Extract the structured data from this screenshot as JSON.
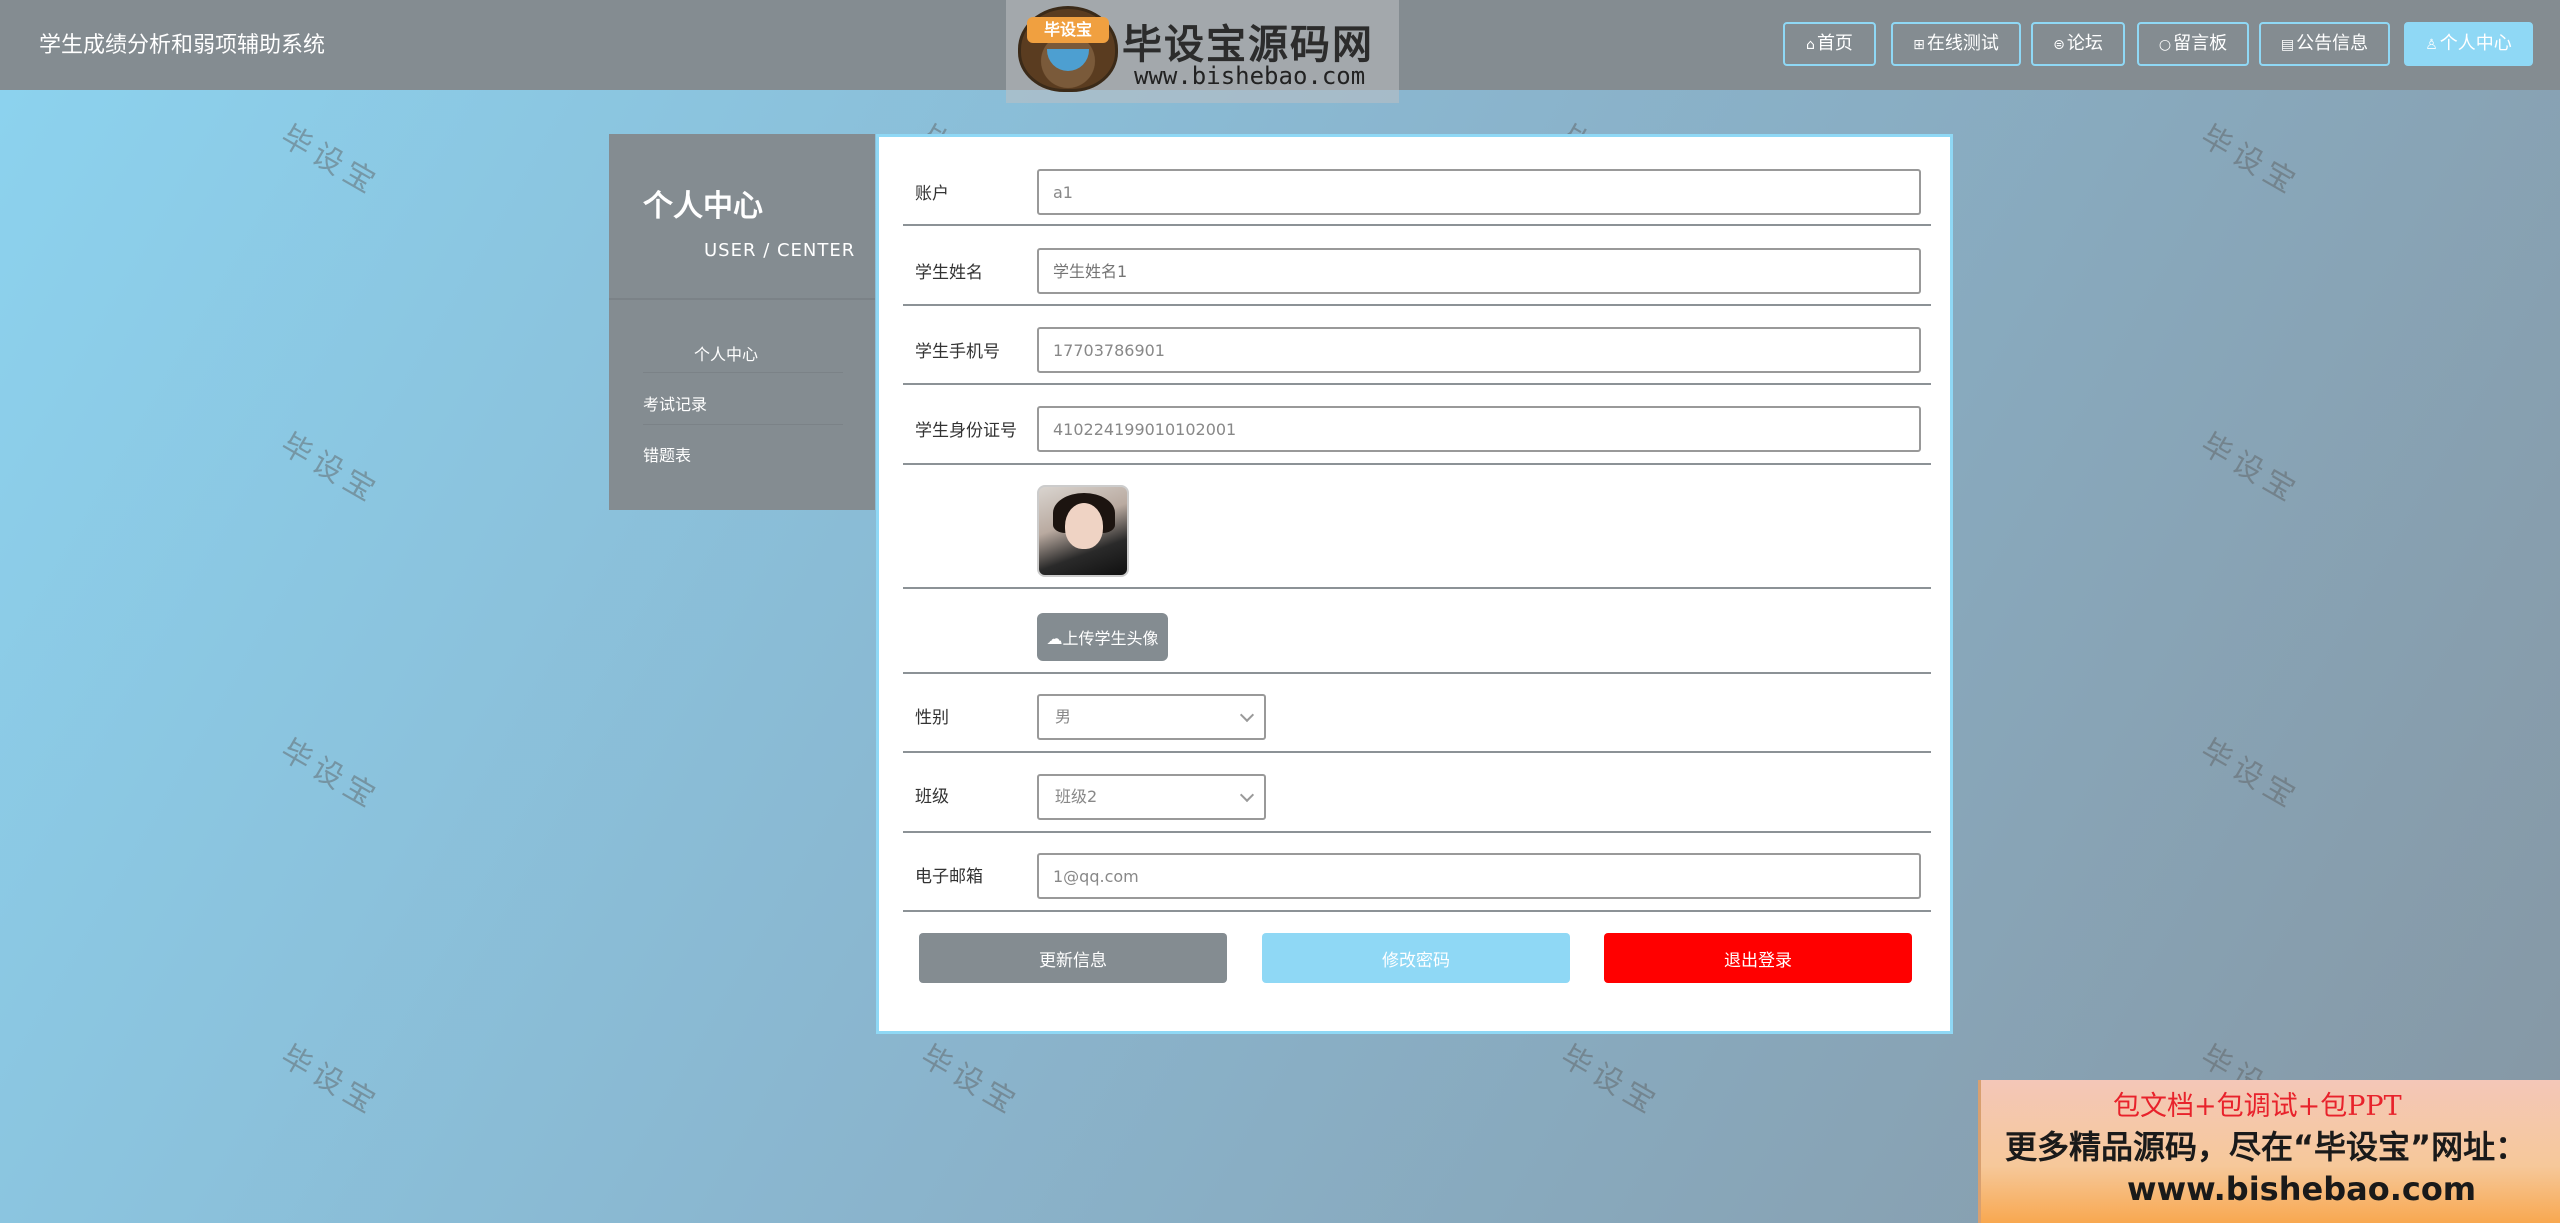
{
  "header": {
    "title": "学生成绩分析和弱项辅助系统",
    "logo": {
      "badge": "毕设宝",
      "name": "毕设宝源码网",
      "url": "www.bishebao.com"
    },
    "nav": [
      {
        "label": "首页",
        "icon": "home-icon"
      },
      {
        "label": "在线测试",
        "icon": "test-icon"
      },
      {
        "label": "论坛",
        "icon": "forum-icon"
      },
      {
        "label": "留言板",
        "icon": "message-icon"
      },
      {
        "label": "公告信息",
        "icon": "notice-icon"
      },
      {
        "label": "个人中心",
        "icon": "user-icon",
        "active": true
      }
    ]
  },
  "watermark": "毕设宝",
  "sidebar": {
    "title": "个人中心",
    "subtitle": "USER / CENTER",
    "items": [
      "个人中心",
      "考试记录",
      "错题表"
    ]
  },
  "form": {
    "account": {
      "label": "账户",
      "value": "a1"
    },
    "name": {
      "label": "学生姓名",
      "placeholder": "学生姓名1"
    },
    "phone": {
      "label": "学生手机号",
      "value": "17703786901"
    },
    "idcard": {
      "label": "学生身份证号",
      "value": "410224199010102001"
    },
    "upload_label": "上传学生头像",
    "gender": {
      "label": "性别",
      "value": "男"
    },
    "class": {
      "label": "班级",
      "value": "班级2"
    },
    "email": {
      "label": "电子邮箱",
      "value": "1@qq.com"
    }
  },
  "actions": {
    "update": "更新信息",
    "change_password": "修改密码",
    "logout": "退出登录"
  },
  "ad": {
    "line1": "包文档+包调试+包PPT",
    "line2": "更多精品源码，尽在“毕设宝”网址：",
    "line3": "www.bishebao.com"
  },
  "colors": {
    "header_bg": "#848c91",
    "accent": "#8fd8f5",
    "danger": "#ff0000"
  }
}
